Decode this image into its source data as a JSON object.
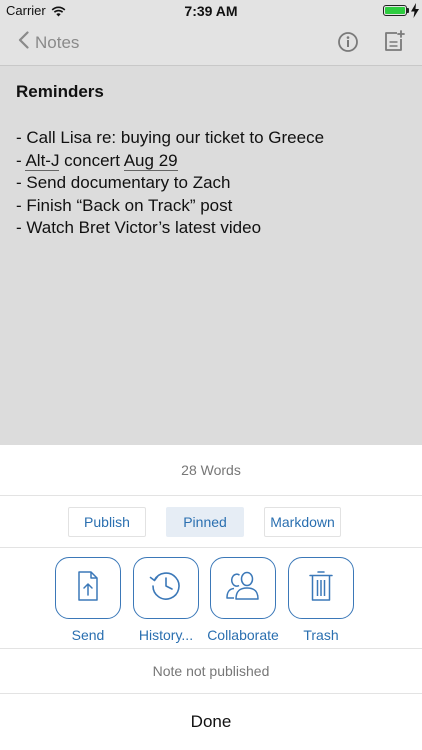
{
  "status_bar": {
    "carrier": "Carrier",
    "time": "7:39 AM",
    "battery_level": 1.0,
    "battery_color": "#2ecc40"
  },
  "nav": {
    "back_label": "Notes",
    "back_icon": "chevron-left-icon",
    "info_icon": "info-icon",
    "new_note_icon": "new-note-icon"
  },
  "note": {
    "title": "Reminders",
    "lines": [
      {
        "prefix": "- Call Lisa re: buying our ticket to Greece",
        "link1": "",
        "middle": "",
        "link2": ""
      },
      {
        "prefix": "- ",
        "link1": "Alt-J",
        "middle": " concert ",
        "link2": "Aug 29"
      },
      {
        "prefix": "- Send documentary to Zach",
        "link1": "",
        "middle": "",
        "link2": ""
      },
      {
        "prefix": "- Finish “Back on Track” post",
        "link1": "",
        "middle": "",
        "link2": ""
      },
      {
        "prefix": "- Watch Bret Victor’s latest video",
        "link1": "",
        "middle": "",
        "link2": ""
      }
    ]
  },
  "sheet": {
    "word_count": "28 Words",
    "toggles": {
      "publish": "Publish",
      "pinned": "Pinned",
      "markdown": "Markdown"
    },
    "actions": {
      "send": "Send",
      "history": "History...",
      "collaborate": "Collaborate",
      "trash": "Trash"
    },
    "publish_status": "Note not published",
    "done": "Done"
  },
  "colors": {
    "accent": "#2a6fb0",
    "note_background": "#dcdcdc",
    "bar_background": "#e3e3e3",
    "selected_toggle": "#e6edf5"
  }
}
